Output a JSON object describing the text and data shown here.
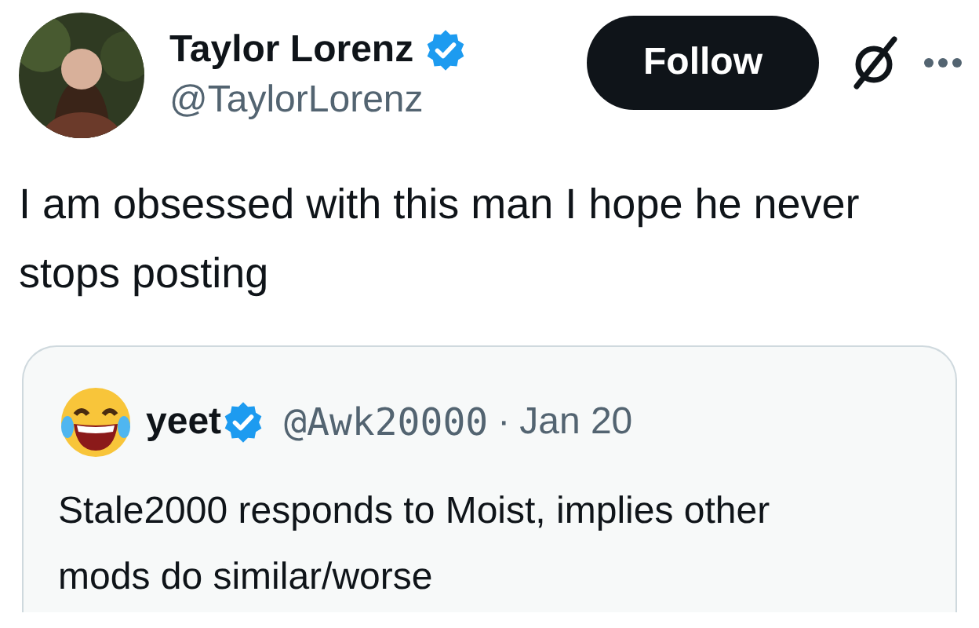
{
  "author": {
    "name": "Taylor Lorenz",
    "verified": true,
    "handle": "@TaylorLorenz"
  },
  "follow_button": "Follow",
  "text": "I am obsessed with this man I hope he never stops posting",
  "quoted_post": {
    "name": "yeet",
    "verified": true,
    "handle": "@Awk20000",
    "separator": "·",
    "date": "Jan 20",
    "text": "Stale2000 responds to Moist, implies other mods do similar/worse"
  }
}
